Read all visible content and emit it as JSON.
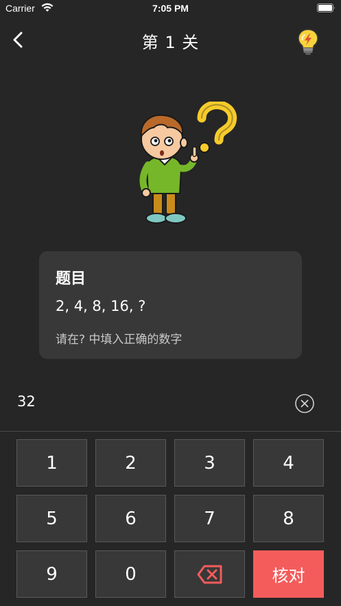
{
  "status_bar": {
    "carrier": "Carrier",
    "time": "7:05 PM",
    "wifi_icon": "wifi-icon",
    "battery_icon": "battery-icon"
  },
  "nav": {
    "back_icon": "chevron-left-icon",
    "title": "第 1 关",
    "hint_icon": "lightbulb-icon"
  },
  "illustration": {
    "name": "thinking-boy-with-question-mark"
  },
  "question": {
    "title": "题目",
    "sequence": "2, 4, 8, 16, ?",
    "instruction": "请在?  中填入正确的数字"
  },
  "answer": {
    "value": "32",
    "clear_icon": "clear-circle-icon"
  },
  "keypad": {
    "keys": [
      "1",
      "2",
      "3",
      "4",
      "5",
      "6",
      "7",
      "8",
      "9",
      "0"
    ],
    "backspace_icon": "backspace-icon",
    "submit_label": "核对"
  },
  "colors": {
    "background": "#262626",
    "card": "#383838",
    "key_border": "#595959",
    "submit": "#f45c5c",
    "backspace_icon": "#f45c5c",
    "hint_icon": "#f6d33c"
  }
}
